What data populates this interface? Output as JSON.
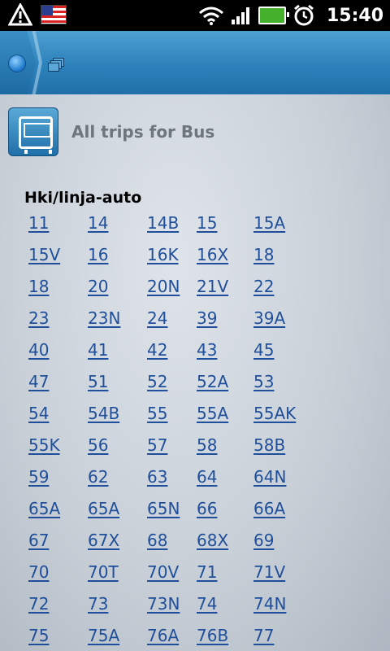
{
  "status_bar": {
    "time": "15:40",
    "icons": [
      "warning-icon",
      "us-flag-icon",
      "wifi-icon",
      "signal-icon",
      "battery-charging-icon",
      "alarm-clock-icon"
    ]
  },
  "header": {
    "accent_color": "#2f84bd",
    "icons": [
      "home-circle-icon",
      "windows-stack-icon"
    ]
  },
  "content": {
    "title": "All trips for Bus",
    "title_icon": "bus-icon",
    "section_title": "Hki/linja-auto",
    "link_color": "#1f4f9a",
    "routes": [
      [
        "11",
        "14",
        "14B",
        "15",
        "15A"
      ],
      [
        "15V",
        "16",
        "16K",
        "16X",
        "18"
      ],
      [
        "18",
        "20",
        "20N",
        "21V",
        "22"
      ],
      [
        "23",
        "23N",
        "24",
        "39",
        "39A"
      ],
      [
        "40",
        "41",
        "42",
        "43",
        "45"
      ],
      [
        "47",
        "51",
        "52",
        "52A",
        "53"
      ],
      [
        "54",
        "54B",
        "55",
        "55A",
        "55AK"
      ],
      [
        "55K",
        "56",
        "57",
        "58",
        "58B"
      ],
      [
        "59",
        "62",
        "63",
        "64",
        "64N"
      ],
      [
        "65A",
        "65A",
        "65N",
        "66",
        "66A"
      ],
      [
        "67",
        "67X",
        "68",
        "68X",
        "69"
      ],
      [
        "70",
        "70T",
        "70V",
        "71",
        "71V"
      ],
      [
        "72",
        "73",
        "73N",
        "74",
        "74N"
      ],
      [
        "75",
        "75A",
        "76A",
        "76B",
        "77"
      ]
    ]
  }
}
